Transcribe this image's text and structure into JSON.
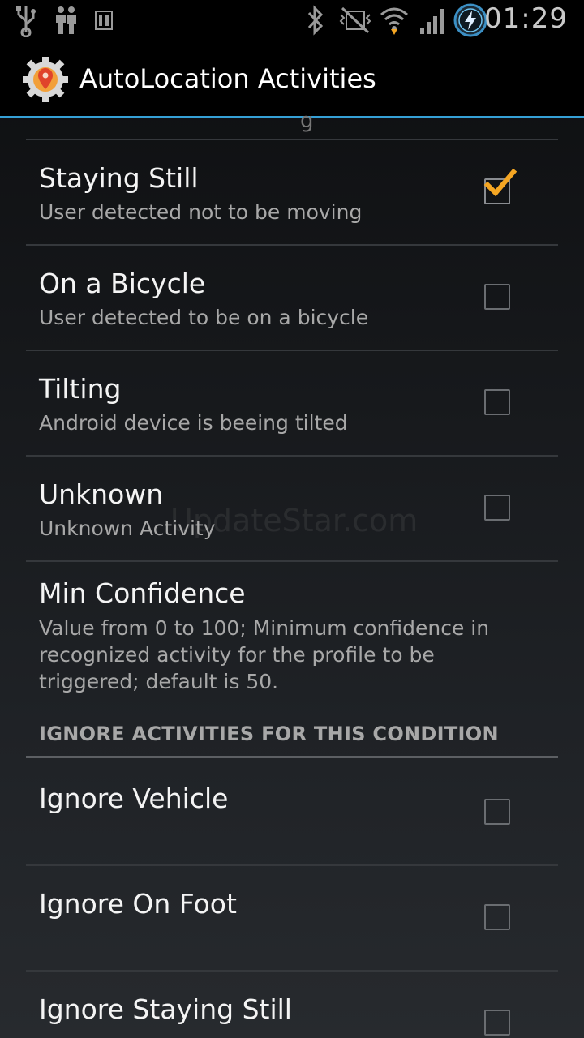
{
  "status_bar": {
    "time": "01:29",
    "icons": [
      "usb-icon",
      "accessibility-icon",
      "pause-icon",
      "bluetooth-icon",
      "vibrate-icon",
      "wifi-icon",
      "signal-icon",
      "battery-charging-icon"
    ]
  },
  "action_bar": {
    "app_icon": "autolocation-gear-icon",
    "title": "AutoLocation Activities"
  },
  "list": {
    "clipped_text": "g",
    "items": [
      {
        "title": "Staying Still",
        "summary": "User detected not to be moving",
        "checked": true
      },
      {
        "title": "On a Bicycle",
        "summary": "User detected to be on a bicycle",
        "checked": false
      },
      {
        "title": "Tilting",
        "summary": "Android device is beeing tilted",
        "checked": false
      },
      {
        "title": "Unknown",
        "summary": "Unknown Activity",
        "checked": false
      }
    ],
    "min_confidence": {
      "title": "Min Confidence",
      "summary": "Value from 0 to 100; Minimum confidence in recognized activity for the profile to be triggered; default is 50."
    },
    "ignore_section": {
      "header": "IGNORE ACTIVITIES FOR THIS CONDITION",
      "items": [
        {
          "title": "Ignore Vehicle",
          "checked": false
        },
        {
          "title": "Ignore On Foot",
          "checked": false
        },
        {
          "title": "Ignore Staying Still",
          "checked": false
        }
      ]
    },
    "watermark": "UpdateStar.com"
  },
  "colors": {
    "accent_line": "#35a0d6",
    "check_orange": "#f5a623"
  }
}
